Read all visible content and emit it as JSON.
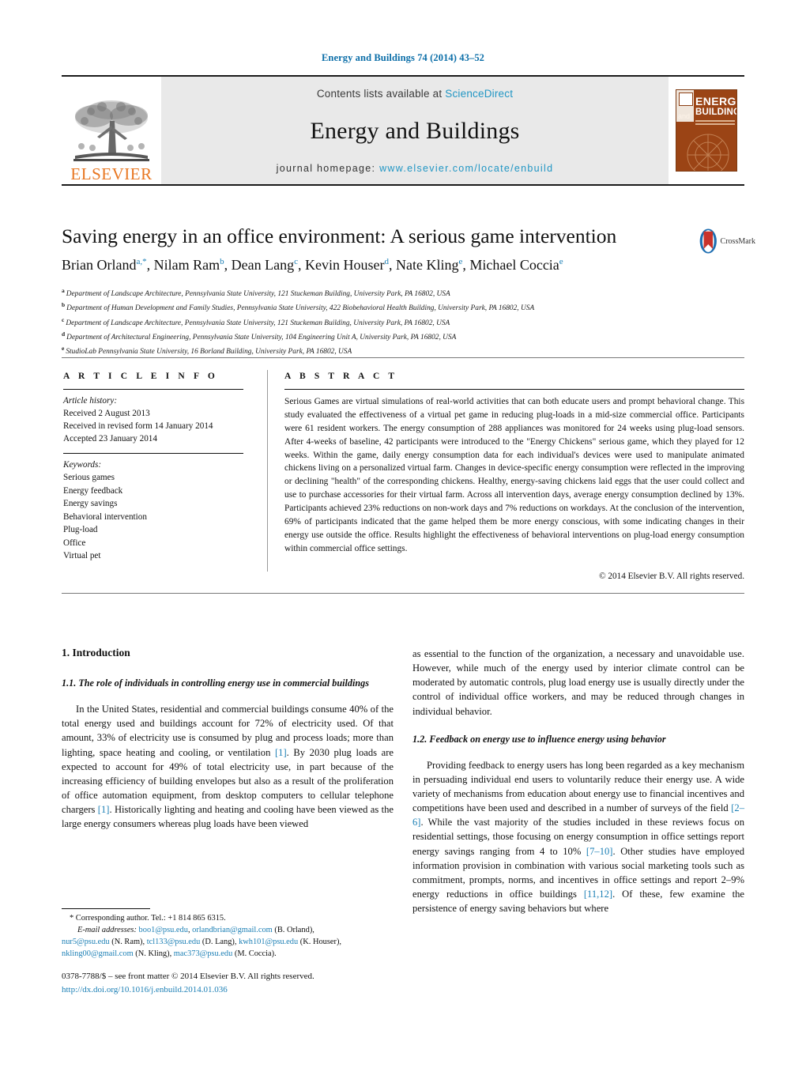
{
  "running_head": "Energy and Buildings 74 (2014) 43–52",
  "masthead": {
    "publisher_name": "ELSEVIER",
    "contents_prefix": "Contents lists available at ",
    "contents_link": "ScienceDirect",
    "journal_name": "Energy and Buildings",
    "homepage_prefix": "journal homepage: ",
    "homepage_url": "www.elsevier.com/locate/enbuild",
    "cover": {
      "line_and": "and",
      "line_energy": "ENERGY",
      "line_buildings": "BUILDINGS"
    },
    "colors": {
      "elsevier_orange": "#e87722",
      "link_blue": "#2196c4",
      "panel_grey": "#e9e9e9",
      "cover_brown": "#9b4415"
    }
  },
  "article": {
    "title": "Saving energy in an office environment: A serious game intervention",
    "crossmark_label": "CrossMark",
    "authors": [
      {
        "name": "Brian Orland",
        "marks": "a,*"
      },
      {
        "name": "Nilam Ram",
        "marks": "b"
      },
      {
        "name": "Dean Lang",
        "marks": "c"
      },
      {
        "name": "Kevin Houser",
        "marks": "d"
      },
      {
        "name": "Nate Kling",
        "marks": "e"
      },
      {
        "name": "Michael Coccia",
        "marks": "e"
      }
    ],
    "affiliations": [
      {
        "mark": "a",
        "text": "Department of Landscape Architecture, Pennsylvania State University, 121 Stuckeman Building, University Park, PA 16802, USA"
      },
      {
        "mark": "b",
        "text": "Department of Human Development and Family Studies, Pennsylvania State University, 422 Biobehavioral Health Building, University Park, PA 16802, USA"
      },
      {
        "mark": "c",
        "text": "Department of Landscape Architecture, Pennsylvania State University, 121 Stuckeman Building, University Park, PA 16802, USA"
      },
      {
        "mark": "d",
        "text": "Department of Architectural Engineering, Pennsylvania State University, 104 Engineering Unit A, University Park, PA 16802, USA"
      },
      {
        "mark": "e",
        "text": "StudioLab Pennsylvania State University, 16 Borland Building, University Park, PA 16802, USA"
      }
    ]
  },
  "article_info": {
    "heading": "A R T I C L E   I N F O",
    "history_label": "Article history:",
    "history": [
      "Received 2 August 2013",
      "Received in revised form 14 January 2014",
      "Accepted 23 January 2014"
    ],
    "keywords_label": "Keywords:",
    "keywords": [
      "Serious games",
      "Energy feedback",
      "Energy savings",
      "Behavioral intervention",
      "Plug-load",
      "Office",
      "Virtual pet"
    ]
  },
  "abstract": {
    "heading": "A B S T R A C T",
    "text": "Serious Games are virtual simulations of real-world activities that can both educate users and prompt behavioral change. This study evaluated the effectiveness of a virtual pet game in reducing plug-loads in a mid-size commercial office. Participants were 61 resident workers. The energy consumption of 288 appliances was monitored for 24 weeks using plug-load sensors. After 4-weeks of baseline, 42 participants were introduced to the \"Energy Chickens\" serious game, which they played for 12 weeks. Within the game, daily energy consumption data for each individual's devices were used to manipulate animated chickens living on a personalized virtual farm. Changes in device-specific energy consumption were reflected in the improving or declining \"health\" of the corresponding chickens. Healthy, energy-saving chickens laid eggs that the user could collect and use to purchase accessories for their virtual farm. Across all intervention days, average energy consumption declined by 13%. Participants achieved 23% reductions on non-work days and 7% reductions on workdays. At the conclusion of the intervention, 69% of participants indicated that the game helped them be more energy conscious, with some indicating changes in their energy use outside the office. Results highlight the effectiveness of behavioral interventions on plug-load energy consumption within commercial office settings.",
    "copyright": "© 2014 Elsevier B.V. All rights reserved."
  },
  "body": {
    "section_1": "1.  Introduction",
    "subsection_1_1": "1.1.  The role of individuals in controlling energy use in commercial buildings",
    "para_left_1_a": "In the United States, residential and commercial buildings consume 40% of the total energy used and buildings account for 72% of electricity used. Of that amount, 33% of electricity use is consumed by plug and process loads; more than lighting, space heating and cooling, or ventilation ",
    "para_left_1_ref1": "[1]",
    "para_left_1_b": ". By 2030 plug loads are expected to account for 49% of total electricity use, in part because of the increasing efficiency of building envelopes but also as a result of the proliferation of office automation equipment, from desktop computers to cellular telephone chargers ",
    "para_left_1_ref2": "[1]",
    "para_left_1_c": ". Historically lighting and heating and cooling have been viewed as the large energy consumers whereas plug loads have been viewed",
    "para_right_1": "as essential to the function of the organization, a necessary and unavoidable use. However, while much of the energy used by interior climate control can be moderated by automatic controls, plug load energy use is usually directly under the control of individual office workers, and may be reduced through changes in individual behavior.",
    "subsection_1_2": "1.2.  Feedback on energy use to influence energy using behavior",
    "para_right_2_a": "Providing feedback to energy users has long been regarded as a key mechanism in persuading individual end users to voluntarily reduce their energy use. A wide variety of mechanisms from education about energy use to financial incentives and competitions have been used and described in a number of surveys of the field ",
    "para_right_2_ref1": "[2–6]",
    "para_right_2_b": ". While the vast majority of the studies included in these reviews focus on residential settings, those focusing on energy consumption in office settings report energy savings ranging from 4 to 10% ",
    "para_right_2_ref2": "[7–10]",
    "para_right_2_c": ". Other studies have employed information provision in combination with various social marketing tools such as commitment, prompts, norms, and incentives in office settings and report 2–9% energy reductions in office buildings ",
    "para_right_2_ref3": "[11,12]",
    "para_right_2_d": ". Of these, few examine the persistence of energy saving behaviors but where"
  },
  "footnote": {
    "corresponding": "*  Corresponding author. Tel.: +1 814 865 6315.",
    "email_label": "E-mail addresses:",
    "emails": [
      {
        "address": "boo1@psu.edu",
        "sep": ", "
      },
      {
        "address": "orlandbrian@gmail.com",
        "owner": "(B. Orland), "
      },
      {
        "address": "nur5@psu.edu",
        "owner": "(N. Ram), "
      },
      {
        "address": "tcl133@psu.edu",
        "owner": "(D. Lang), "
      },
      {
        "address": "kwh101@psu.edu",
        "owner": "(K. Houser), "
      },
      {
        "address": "nkling00@gmail.com",
        "owner": "(N. Kling), "
      },
      {
        "address": "mac373@psu.edu",
        "owner": "(M. Coccia)."
      }
    ]
  },
  "imprint": {
    "issn_line": "0378-7788/$ – see front matter © 2014 Elsevier B.V. All rights reserved.",
    "doi": "http://dx.doi.org/10.1016/j.enbuild.2014.01.036"
  }
}
